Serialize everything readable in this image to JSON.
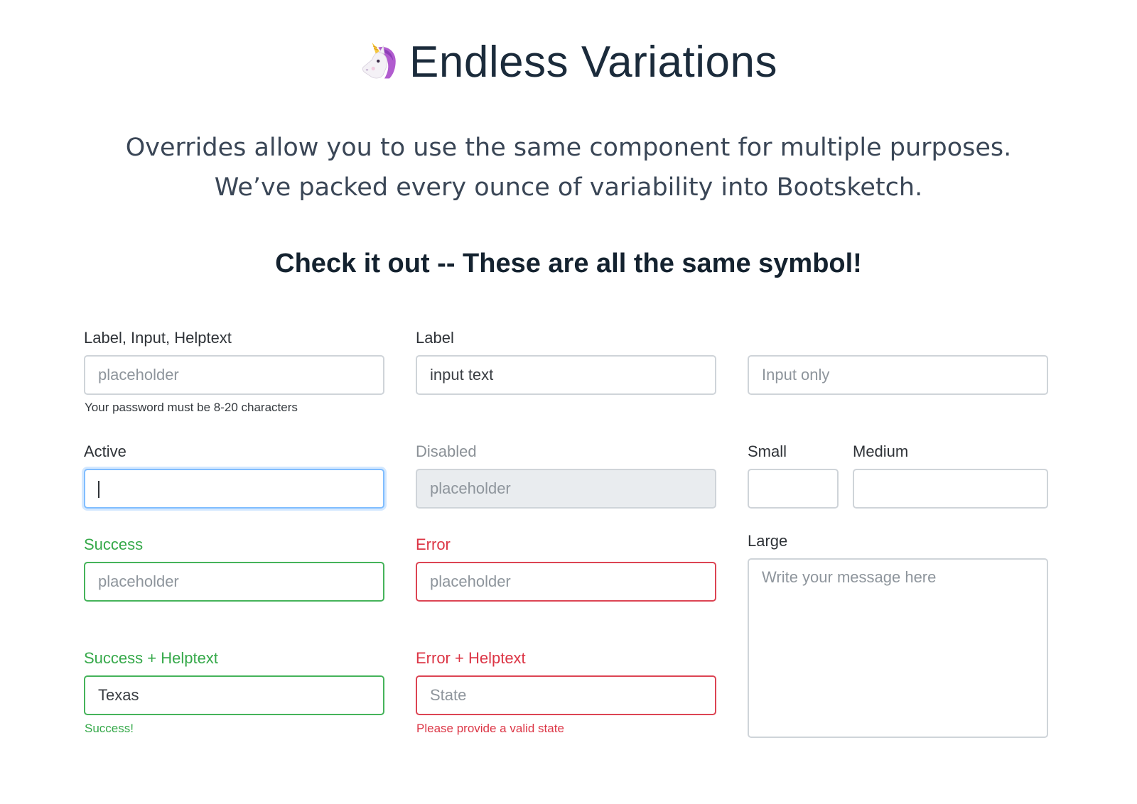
{
  "header": {
    "emoji_icon": "unicorn-icon",
    "title": "Endless Variations",
    "lead": "Overrides allow you to use the same component for multiple purposes. We’ve packed every ounce of variability into Bootsketch.",
    "subhead": "Check it out -- These are all the same symbol!"
  },
  "colors": {
    "success": "#36a94a",
    "error": "#dc3545",
    "focus": "#80bdff",
    "disabled_bg": "#e9ecef"
  },
  "fields": {
    "label_input_helptext": {
      "label": "Label, Input, Helptext",
      "placeholder": "placeholder",
      "help": "Your password must be 8-20 characters"
    },
    "label_only": {
      "label": "Label",
      "value": "input text"
    },
    "input_only": {
      "placeholder": "Input only"
    },
    "active": {
      "label": "Active"
    },
    "disabled": {
      "label": "Disabled",
      "placeholder": "placeholder"
    },
    "small": {
      "label": "Small"
    },
    "medium": {
      "label": "Medium"
    },
    "success": {
      "label": "Success",
      "placeholder": "placeholder"
    },
    "error": {
      "label": "Error",
      "placeholder": "placeholder"
    },
    "large": {
      "label": "Large",
      "placeholder": "Write your message here"
    },
    "success_helptext": {
      "label": "Success + Helptext",
      "value": "Texas",
      "help": "Success!"
    },
    "error_helptext": {
      "label": "Error + Helptext",
      "placeholder": "State",
      "help": "Please provide a valid state"
    }
  }
}
